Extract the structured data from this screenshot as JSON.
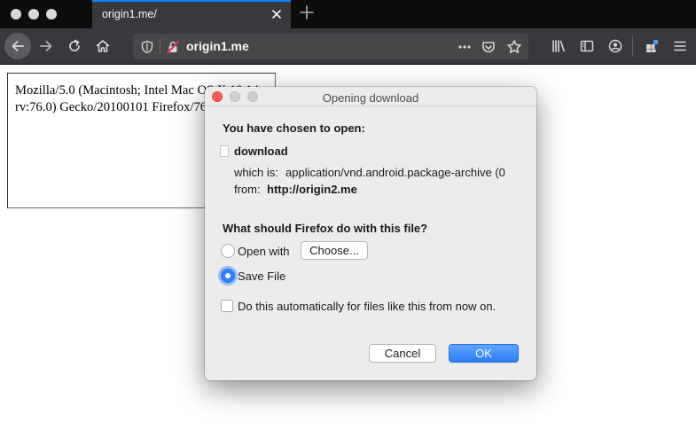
{
  "browser": {
    "tab": {
      "title": "origin1.me/"
    },
    "url": "origin1.me"
  },
  "page": {
    "user_agent": "Mozilla/5.0 (Macintosh; Intel Mac OS X 10.14; rv:76.0) Gecko/20100101 Firefox/76.0"
  },
  "dialog": {
    "title": "Opening download",
    "heading": "You have chosen to open:",
    "file_name": "download",
    "which_is_label": "which is:",
    "which_is_value": "application/vnd.android.package-archive (0",
    "from_label": "from:",
    "from_value": "http://origin2.me",
    "question": "What should Firefox do with this file?",
    "open_with_label": "Open with",
    "choose_button": "Choose...",
    "save_file_label": "Save File",
    "selected_option": "Save File",
    "auto_label": "Do this automatically for files like this from now on.",
    "auto_checked": false,
    "cancel_button": "Cancel",
    "ok_button": "OK"
  },
  "colors": {
    "accent": "#0a84ff",
    "toolbar": "#38383d",
    "tabstrip": "#0c0c0d",
    "primary_button": "#2d7cf6"
  }
}
